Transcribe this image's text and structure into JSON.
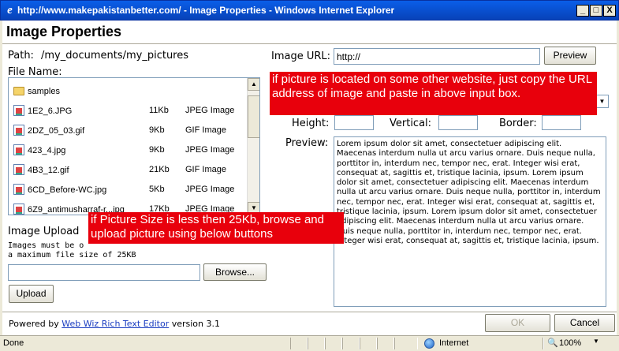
{
  "window": {
    "title": "http://www.makepakistanbetter.com/ - Image Properties - Windows Internet Explorer",
    "minimize": "_",
    "maximize": "□",
    "close": "X"
  },
  "dialog": {
    "title": "Image Properties",
    "path_label": "Path:",
    "path_value": "/my_documents/my_pictures",
    "file_name_label": "File Name:",
    "files": [
      {
        "name": "samples",
        "size": "",
        "type": "",
        "kind": "folder"
      },
      {
        "name": "1E2_6.JPG",
        "size": "11Kb",
        "type": "JPEG Image",
        "kind": "image"
      },
      {
        "name": "2DZ_05_03.gif",
        "size": "9Kb",
        "type": "GIF Image",
        "kind": "image"
      },
      {
        "name": "423_4.jpg",
        "size": "9Kb",
        "type": "JPEG Image",
        "kind": "image"
      },
      {
        "name": "4B3_12.gif",
        "size": "21Kb",
        "type": "GIF Image",
        "kind": "image"
      },
      {
        "name": "6CD_Before-WC.jpg",
        "size": "5Kb",
        "type": "JPEG Image",
        "kind": "image"
      },
      {
        "name": "6Z9_antimusharraf-r...jpg",
        "size": "17Kb",
        "type": "JPEG Image",
        "kind": "image"
      }
    ],
    "image_upload_label": "Image Upload",
    "upload_note_1": "Images must be o",
    "upload_note_2": "a maximum file size of 25KB",
    "browse_label": "Browse...",
    "upload_label": "Upload",
    "image_url_label": "Image URL:",
    "image_url_value": "http://",
    "preview_button": "Preview",
    "height_label": "Height:",
    "vertical_label": "Vertical:",
    "border_label": "Border:",
    "preview_label": "Preview:",
    "preview_text": "Lorem ipsum dolor sit amet, consectetuer adipiscing elit. Maecenas interdum nulla ut arcu varius ornare. Duis neque nulla, porttitor in, interdum nec, tempor nec, erat. Integer wisi erat, consequat at, sagittis et, tristique lacinia, ipsum. Lorem ipsum dolor sit amet, consectetuer adipiscing elit. Maecenas interdum nulla ut arcu varius ornare. Duis neque nulla, porttitor in, interdum nec, tempor nec, erat. Integer wisi erat, consequat at, sagittis et, tristique lacinia, ipsum. Lorem ipsum dolor sit amet, consectetuer adipiscing elit. Maecenas interdum nulla ut arcu varius ornare. Duis neque nulla, porttitor in, interdum nec, tempor nec, erat. Integer wisi erat, consequat at, sagittis et, tristique lacinia, ipsum.",
    "callout_url": "if picture is located on some other website, just copy the URL address of image and paste in above input box.",
    "callout_upload": "if Picture Size is less then 25Kb, browse and upload picture using below buttons",
    "powered_by_prefix": "Powered by",
    "powered_by_link": "Web Wiz Rich Text Editor",
    "powered_by_suffix": "version 3.1",
    "ok_label": "OK",
    "cancel_label": "Cancel"
  },
  "statusbar": {
    "status": "Done",
    "zone": "Internet",
    "zoom": "100%"
  },
  "colors": {
    "titlebar": "#0a5ee8",
    "callout": "#e8000c",
    "link": "#1a3dc1"
  }
}
